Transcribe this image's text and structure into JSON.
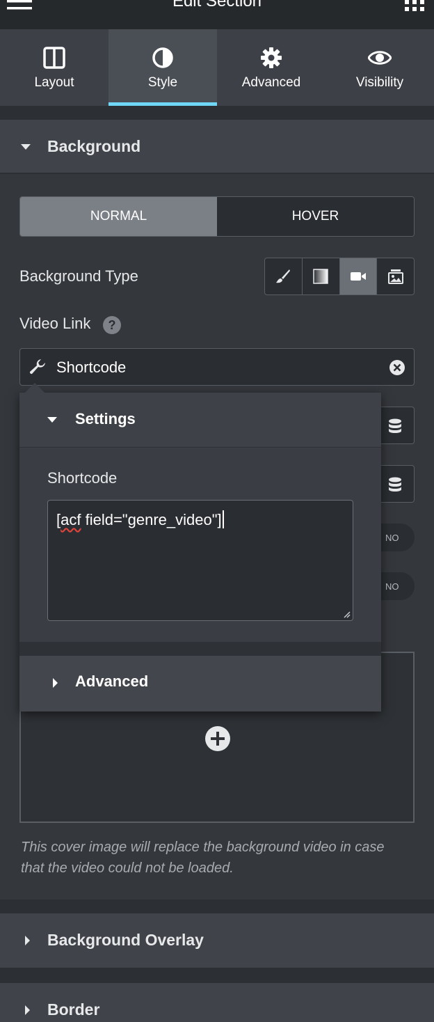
{
  "header": {
    "title": "Edit Section"
  },
  "tabs": [
    {
      "label": "Layout",
      "icon": "layout-icon",
      "active": false
    },
    {
      "label": "Style",
      "icon": "contrast-icon",
      "active": true
    },
    {
      "label": "Advanced",
      "icon": "gear-icon",
      "active": false
    },
    {
      "label": "Visibility",
      "icon": "eye-icon",
      "active": false
    }
  ],
  "background": {
    "title": "Background",
    "state_tabs": {
      "normal": "NORMAL",
      "hover": "HOVER",
      "selected": "NORMAL"
    },
    "type_label": "Background Type",
    "type_options": [
      "brush-icon",
      "gradient-icon",
      "video-icon",
      "slideshow-icon"
    ],
    "type_selected": "video-icon",
    "video_link_label": "Video Link",
    "video_link_value": "Shortcode",
    "toggle_no_1": "NO",
    "toggle_no_2": "NO",
    "cover_note": "This cover image will replace the background video in case that the video could not be loaded."
  },
  "popup": {
    "settings_title": "Settings",
    "shortcode_label": "Shortcode",
    "shortcode_value_prefix": "[",
    "shortcode_value_misspelled": "acf",
    "shortcode_value_rest": " field=\"genre_video\"]",
    "advanced_title": "Advanced"
  },
  "sections": {
    "overlay_title": "Background Overlay",
    "border_title": "Border"
  },
  "colors": {
    "accent": "#71d7f7",
    "panel": "#34373c",
    "input": "#2a2d31"
  }
}
